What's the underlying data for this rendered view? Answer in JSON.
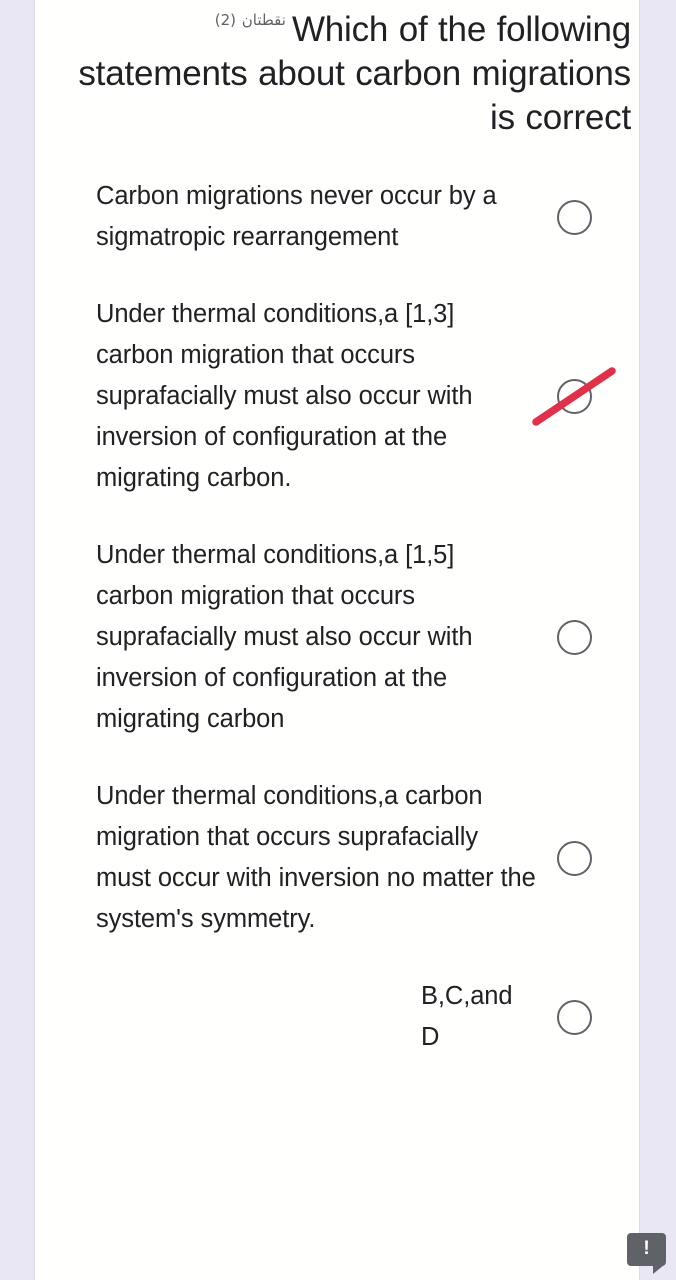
{
  "page": {
    "background_color": "#e9e7f3",
    "card_color": "#fffffd",
    "text_color": "#202124",
    "accent_red": "#e0304a",
    "radio_stroke": "#5f6368"
  },
  "question": {
    "points_label": "نقطتان (2)",
    "title": "Which of the following statements about carbon migrations is correct"
  },
  "options": [
    {
      "id": "option-a",
      "text": "Carbon migrations never occur by a sigmatropic rearrangement",
      "selected": false,
      "struck_out": false
    },
    {
      "id": "option-b",
      "text": "Under thermal conditions,a [1,3] carbon migration that occurs suprafacially must also occur with inversion of configuration at the migrating carbon.",
      "selected": false,
      "struck_out": true
    },
    {
      "id": "option-c",
      "text": "Under thermal conditions,a [1,5] carbon migration that occurs suprafacially must also occur with inversion of configuration at the migrating carbon",
      "selected": false,
      "struck_out": false
    },
    {
      "id": "option-d",
      "text": "Under thermal conditions,a carbon migration that occurs suprafacially must occur with inversion no matter the system's symmetry.",
      "selected": false,
      "struck_out": false
    },
    {
      "id": "option-e",
      "text": "B,C,and D",
      "selected": false,
      "struck_out": false
    }
  ],
  "feedback": {
    "icon": "exclamation-bubble-icon",
    "glyph": "!"
  }
}
